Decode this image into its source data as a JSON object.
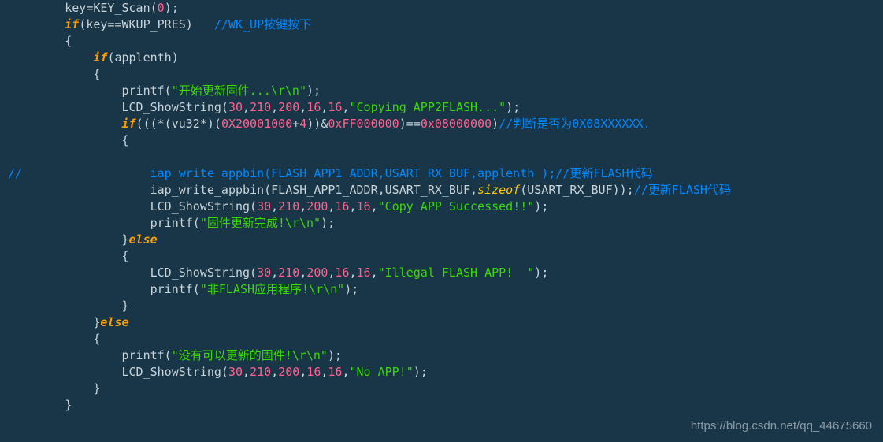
{
  "line1": {
    "a": "        key=KEY_Scan(",
    "n0": "0",
    "b": ");"
  },
  "line2": {
    "a": "        ",
    "kw": "if",
    "b": "(key==WKUP_PRES)   ",
    "cm": "//WK_UP按键按下"
  },
  "line3": "        {",
  "line4": {
    "a": "            ",
    "kw": "if",
    "b": "(applenth)"
  },
  "line5": "            {",
  "line6": {
    "a": "                printf(",
    "s": "\"开始更新固件...\\r\\n\"",
    "b": ");"
  },
  "line7": {
    "a": "                LCD_ShowString(",
    "n1": "30",
    "c1": ",",
    "n2": "210",
    "c2": ",",
    "n3": "200",
    "c3": ",",
    "n4": "16",
    "c4": ",",
    "n5": "16",
    "c5": ",",
    "s": "\"Copying APP2FLASH...\"",
    "b": ");"
  },
  "line8": {
    "a": "                ",
    "kw": "if",
    "b": "(((*(vu32*)(",
    "n1": "0X20001000",
    "c1": "+",
    "n2": "4",
    "c2": "))&",
    "n3": "0xFF000000",
    "c3": ")==",
    "n4": "0x08000000",
    "c4": ")",
    "cm": "//判断是否为0X08XXXXXX."
  },
  "line9": "                {",
  "line10": "",
  "line11": {
    "cm1": "//",
    "a": "                  iap_write_appbin(FLASH_APP1_ADDR,USART_RX_BUF,applenth );",
    "cm2": "//更新FLASH代码"
  },
  "line12": {
    "a": "                    iap_write_appbin(FLASH_APP1_ADDR,USART_RX_BUF,",
    "kw": "sizeof",
    "b": "(USART_RX_BUF));",
    "cm": "//更新FLASH代码"
  },
  "line13": {
    "a": "                    LCD_ShowString(",
    "n1": "30",
    "c1": ",",
    "n2": "210",
    "c2": ",",
    "n3": "200",
    "c3": ",",
    "n4": "16",
    "c4": ",",
    "n5": "16",
    "c5": ",",
    "s": "\"Copy APP Successed!!\"",
    "b": ");"
  },
  "line14": {
    "a": "                    printf(",
    "s": "\"固件更新完成!\\r\\n\"",
    "b": ");"
  },
  "line15": {
    "a": "                }",
    "kw": "else"
  },
  "line16": "                {",
  "line17": {
    "a": "                    LCD_ShowString(",
    "n1": "30",
    "c1": ",",
    "n2": "210",
    "c2": ",",
    "n3": "200",
    "c3": ",",
    "n4": "16",
    "c4": ",",
    "n5": "16",
    "c5": ",",
    "s": "\"Illegal FLASH APP!  \"",
    "b": ");"
  },
  "line18": {
    "a": "                    printf(",
    "s": "\"非FLASH应用程序!\\r\\n\"",
    "b": ");"
  },
  "line19": "                }",
  "line20": {
    "a": "            }",
    "kw": "else"
  },
  "line21": "            {",
  "line22": {
    "a": "                printf(",
    "s": "\"没有可以更新的固件!\\r\\n\"",
    "b": ");"
  },
  "line23": {
    "a": "                LCD_ShowString(",
    "n1": "30",
    "c1": ",",
    "n2": "210",
    "c2": ",",
    "n3": "200",
    "c3": ",",
    "n4": "16",
    "c4": ",",
    "n5": "16",
    "c5": ",",
    "s": "\"No APP!\"",
    "b": ");"
  },
  "line24": "            }",
  "line25": "        }",
  "watermark": "https://blog.csdn.net/qq_44675660"
}
